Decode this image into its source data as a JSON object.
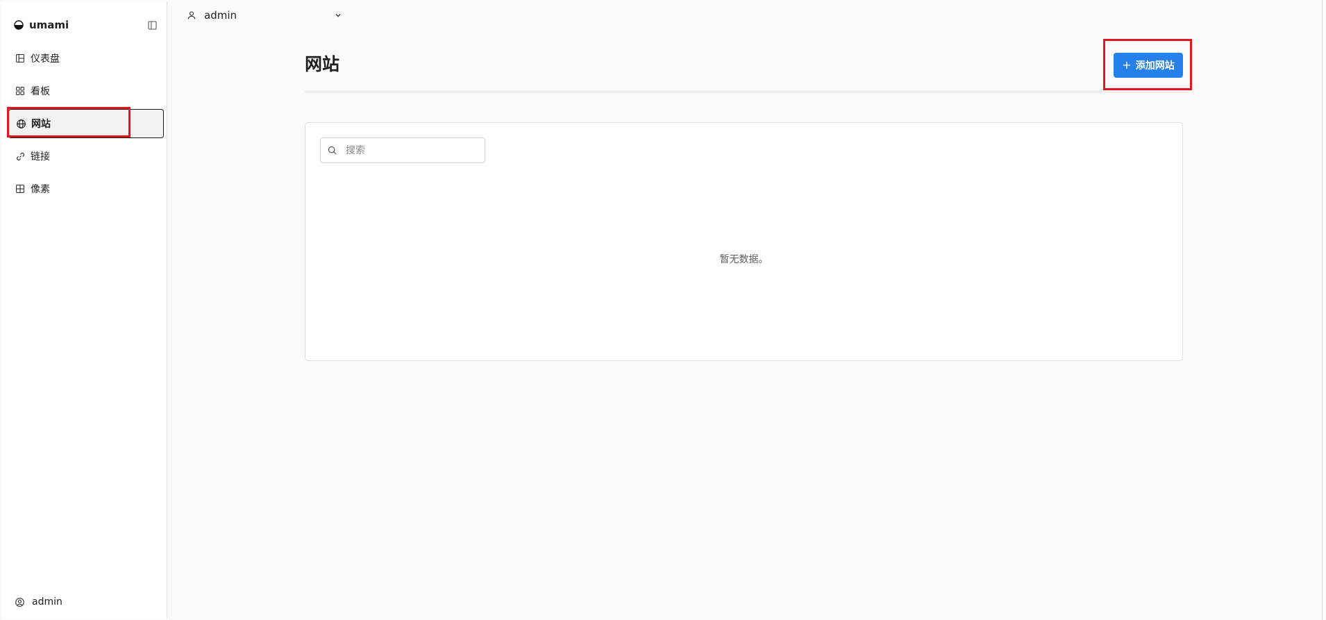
{
  "app": {
    "name": "umami"
  },
  "sidebar": {
    "items": [
      {
        "label": "仪表盘",
        "icon": "layout-dashboard-icon"
      },
      {
        "label": "看板",
        "icon": "boards-icon"
      },
      {
        "label": "网站",
        "icon": "globe-icon",
        "active": true
      },
      {
        "label": "链接",
        "icon": "link-icon"
      },
      {
        "label": "像素",
        "icon": "grid-icon"
      }
    ],
    "footer_user": "admin"
  },
  "topbar": {
    "user": "admin"
  },
  "page": {
    "title": "网站",
    "add_button": "添加网站"
  },
  "search": {
    "placeholder": "搜索",
    "value": ""
  },
  "table": {
    "empty_message": "暂无数据。"
  },
  "colors": {
    "accent": "#2680eb",
    "highlight": "#e0161c",
    "background": "#fafafa"
  }
}
